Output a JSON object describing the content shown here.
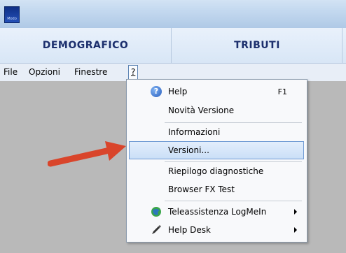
{
  "app": {
    "logo_text": "Modo"
  },
  "modules": [
    "DEMOGRAFICO",
    "TRIBUTI"
  ],
  "menu": {
    "file": "File",
    "opzioni": "Opzioni",
    "finestre": "Finestre",
    "help": "?"
  },
  "dropdown": {
    "items": [
      {
        "label": "Help",
        "shortcut": "F1",
        "icon": "help-icon"
      },
      {
        "label": "Novità Versione"
      },
      {
        "label": "Informazioni"
      },
      {
        "label": "Versioni...",
        "highlighted": true
      },
      {
        "label": "Riepilogo diagnostiche"
      },
      {
        "label": "Browser FX Test"
      },
      {
        "label": "Teleassistenza LogMeIn",
        "icon": "globe-icon",
        "submenu": true
      },
      {
        "label": "Help Desk",
        "icon": "pen-icon",
        "submenu": true
      }
    ]
  },
  "colors": {
    "module_text": "#1c2f6d",
    "highlight_border": "#6f9ad3",
    "arrow": "#d9452b"
  }
}
